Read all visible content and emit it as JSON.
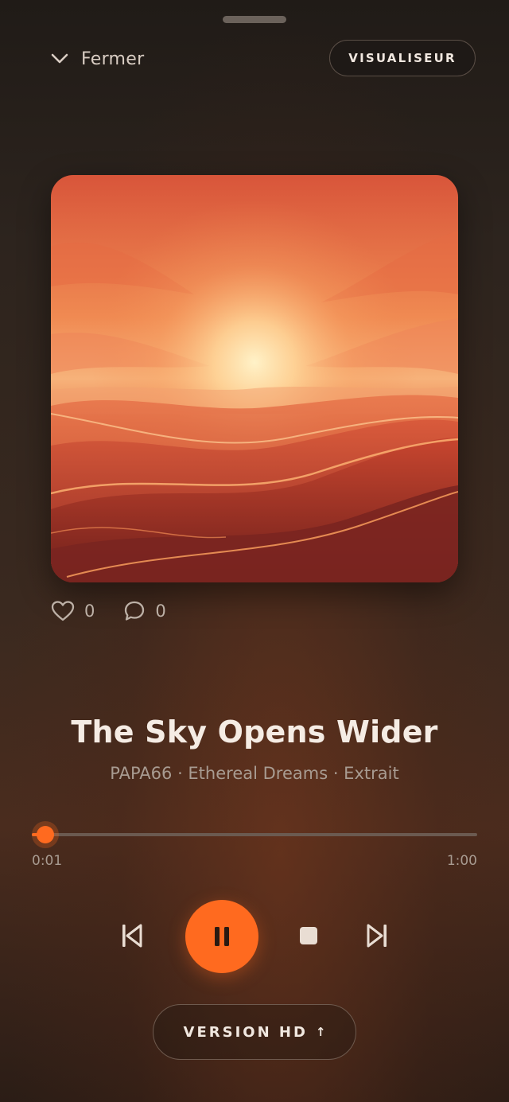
{
  "header": {
    "close_label": "Fermer",
    "visualiser_label": "VISUALISEUR"
  },
  "artwork": {
    "description_icon": "album-art-sunset-dunes"
  },
  "reactions": {
    "likes": "0",
    "comments": "0"
  },
  "track": {
    "title": "The Sky Opens Wider",
    "subtitle": "PAPA66 · Ethereal Dreams · Extrait"
  },
  "progress": {
    "elapsed": "0:01",
    "duration": "1:00",
    "fraction": 0.0167
  },
  "controls": {
    "prev_icon": "skip-previous-icon",
    "play_icon": "pause-icon",
    "stop_icon": "stop-icon",
    "next_icon": "skip-next-icon"
  },
  "hd": {
    "label": "VERSION HD",
    "arrow": "↑"
  },
  "colors": {
    "accent": "#ff6a1f",
    "background_top": "#201b17",
    "background_bottom": "#4a2c1e"
  }
}
